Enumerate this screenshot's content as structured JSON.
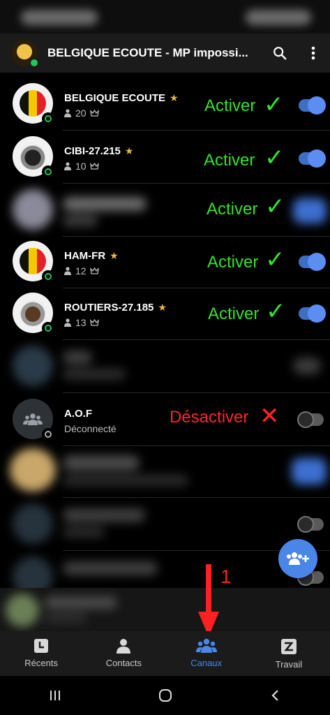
{
  "header": {
    "title": "BELGIQUE ECOUTE - MP impossi...",
    "search_icon": "search-icon",
    "menu_icon": "more-vert-icon"
  },
  "channels": [
    {
      "name": "BELGIQUE ECOUTE",
      "count": "20",
      "annotation": "Activer",
      "toggle": "on"
    },
    {
      "name": "CIBI-27.215",
      "count": "10",
      "annotation": "Activer",
      "toggle": "on"
    },
    {
      "name": "",
      "count": "",
      "annotation": "Activer",
      "toggle": "on"
    },
    {
      "name": "HAM-FR",
      "count": "12",
      "annotation": "Activer",
      "toggle": "on"
    },
    {
      "name": "ROUTIERS-27.185",
      "count": "13",
      "annotation": "Activer",
      "toggle": "on"
    },
    {
      "name": "",
      "count": "",
      "annotation": "",
      "toggle": "off"
    },
    {
      "name": "A.O.F",
      "status": "Déconnecté",
      "annotation": "Désactiver",
      "toggle": "off"
    },
    {
      "name": "",
      "count": "",
      "annotation": "",
      "toggle": "on"
    },
    {
      "name": "",
      "count": "",
      "annotation": "",
      "toggle": "off"
    },
    {
      "name": "",
      "count": "",
      "annotation": "",
      "toggle": "off"
    }
  ],
  "bottom_nav": [
    {
      "label": "Récents",
      "icon": "recent-icon"
    },
    {
      "label": "Contacts",
      "icon": "person-icon"
    },
    {
      "label": "Canaux",
      "icon": "group-icon",
      "active": true
    },
    {
      "label": "Travail",
      "icon": "work-icon"
    }
  ],
  "annotation": {
    "step": "1"
  },
  "colors": {
    "accent": "#4a86e8",
    "enabled": "#35e22a",
    "disabled": "#ff2525"
  }
}
